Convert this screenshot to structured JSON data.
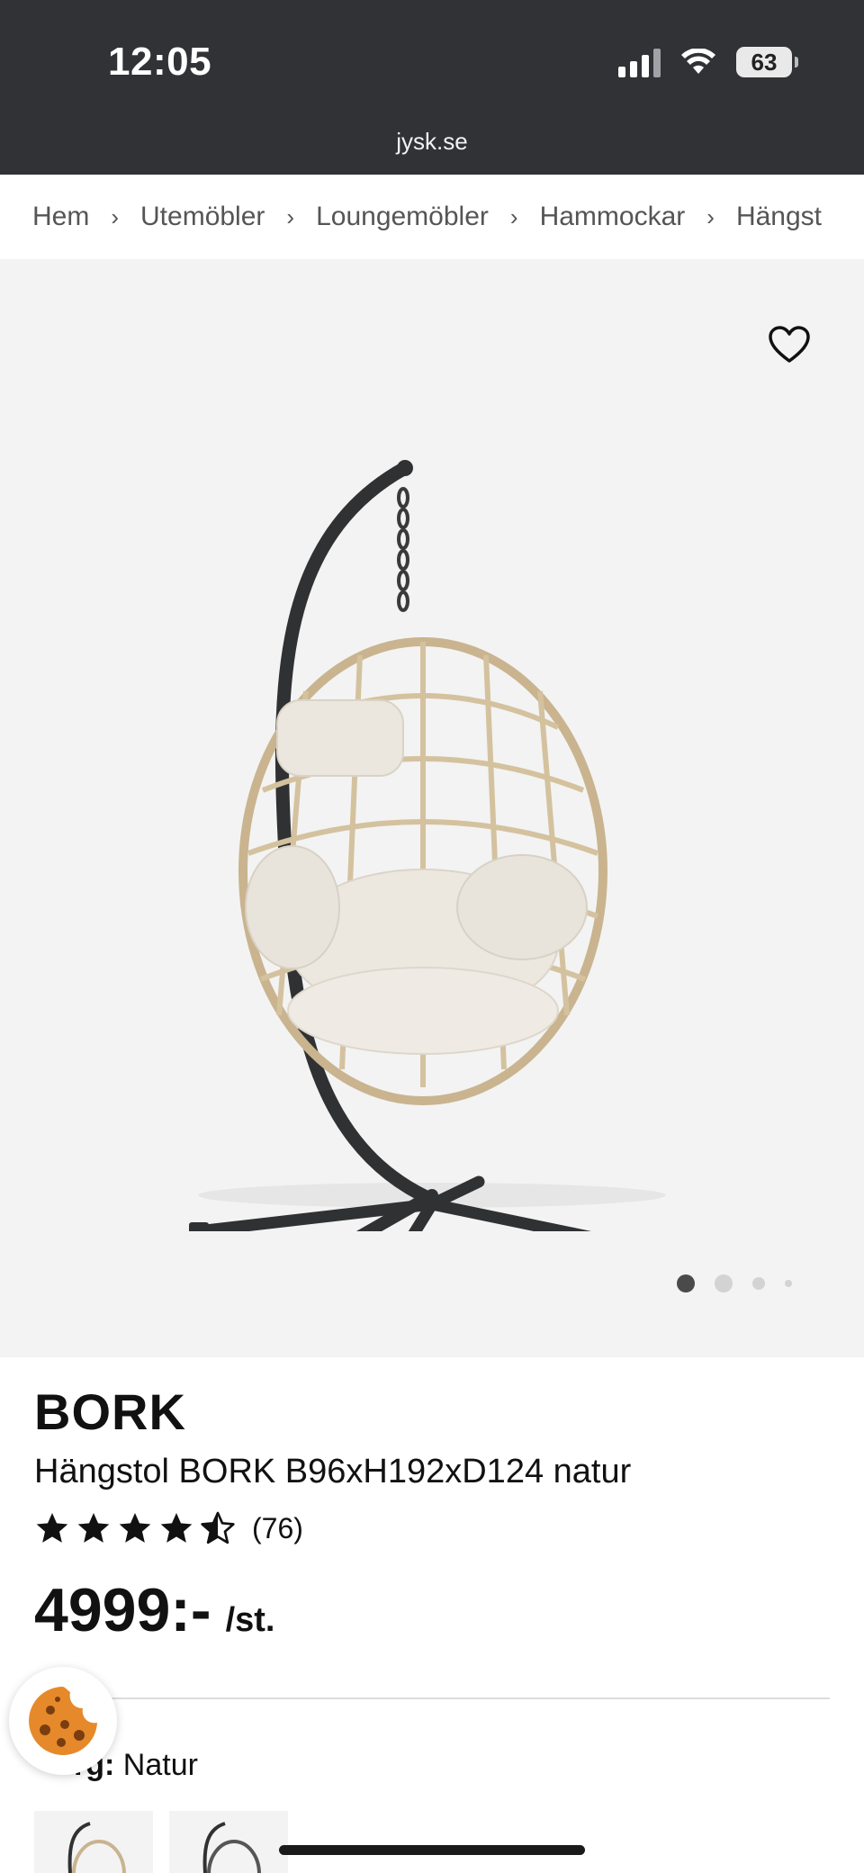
{
  "status_bar": {
    "time": "12:05",
    "battery_level": "63",
    "icons": [
      "signal-icon",
      "wifi-icon",
      "battery-icon"
    ]
  },
  "browser": {
    "url": "jysk.se"
  },
  "breadcrumb": {
    "items": [
      "Hem",
      "Utemöbler",
      "Loungemöbler",
      "Hammockar",
      "Hängst"
    ],
    "separator": "›"
  },
  "gallery": {
    "image_subject": "hanging-egg-chair",
    "favorite_icon": "heart-icon",
    "active_slide": 1,
    "slide_count": 4
  },
  "product": {
    "brand": "BORK",
    "name": "Hängstol BORK B96xH192xD124 natur",
    "rating": 4.5,
    "review_count": "(76)",
    "price": "4999:-",
    "price_unit": "/st."
  },
  "variant": {
    "label_visible": "rg:",
    "value": "Natur"
  },
  "cookie_button": {
    "icon": "cookie-icon"
  },
  "colors": {
    "topbar": "#303236",
    "gallery_bg": "#f3f3f3",
    "text": "#111111",
    "crumb_text": "#555555"
  }
}
